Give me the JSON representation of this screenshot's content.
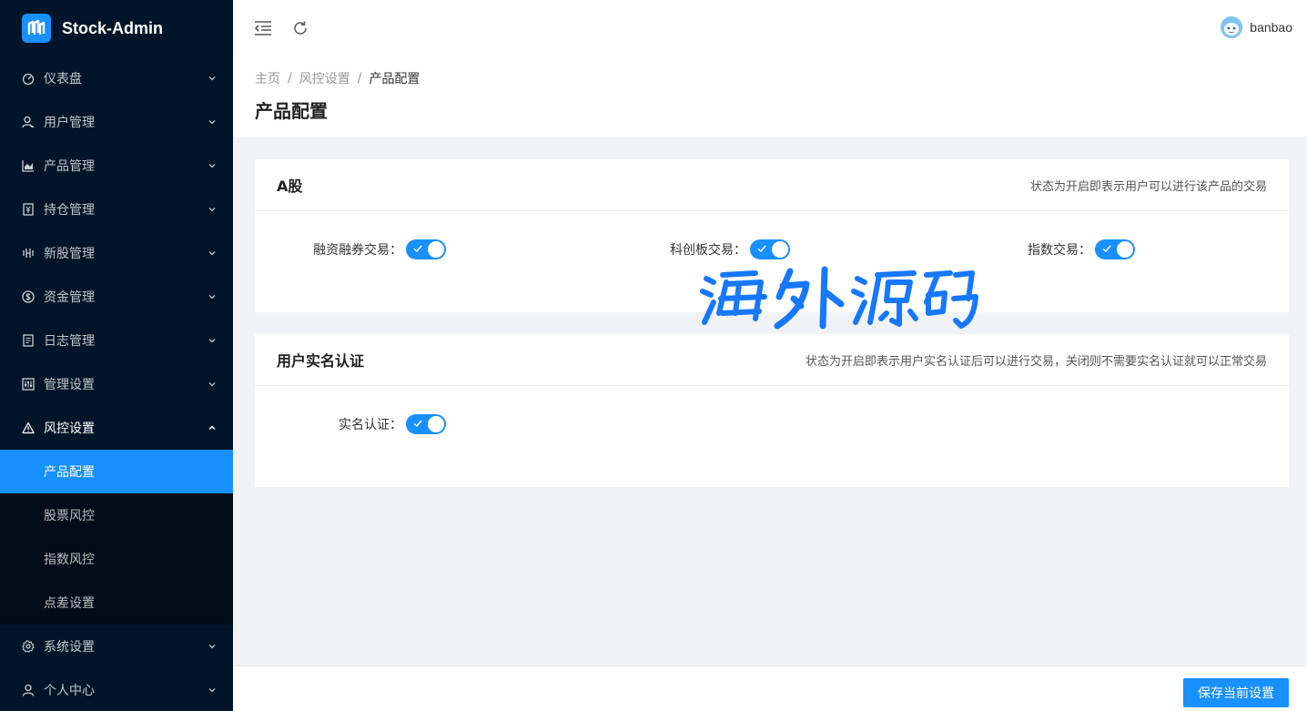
{
  "app": {
    "title": "Stock-Admin"
  },
  "sidebar": {
    "items": [
      {
        "label": "仪表盘",
        "icon": "dashboard-icon"
      },
      {
        "label": "用户管理",
        "icon": "user-manage-icon"
      },
      {
        "label": "产品管理",
        "icon": "area-chart-icon"
      },
      {
        "label": "持仓管理",
        "icon": "account-book-icon"
      },
      {
        "label": "新股管理",
        "icon": "bars-icon"
      },
      {
        "label": "资金管理",
        "icon": "dollar-icon"
      },
      {
        "label": "日志管理",
        "icon": "log-icon"
      },
      {
        "label": "管理设置",
        "icon": "setting-box-icon"
      },
      {
        "label": "风控设置",
        "icon": "warning-icon"
      }
    ],
    "submenu": [
      {
        "label": "产品配置"
      },
      {
        "label": "股票风控"
      },
      {
        "label": "指数风控"
      },
      {
        "label": "点差设置"
      }
    ],
    "bottom_items": [
      {
        "label": "系统设置",
        "icon": "gear-icon"
      },
      {
        "label": "个人中心",
        "icon": "person-icon"
      }
    ]
  },
  "header": {
    "user_name": "banbao"
  },
  "breadcrumb": [
    "主页",
    "风控设置",
    "产品配置"
  ],
  "page": {
    "title": "产品配置"
  },
  "cards": {
    "a_share": {
      "title": "A股",
      "note": "状态为开启即表示用户可以进行该产品的交易",
      "fields": [
        {
          "label": "融资融券交易：",
          "enabled": true
        },
        {
          "label": "科创板交易：",
          "enabled": true
        },
        {
          "label": "指数交易：",
          "enabled": true
        }
      ]
    },
    "realname": {
      "title": "用户实名认证",
      "note": "状态为开启即表示用户实名认证后可以进行交易，关闭则不需要实名认证就可以正常交易",
      "fields": [
        {
          "label": "实名认证：",
          "enabled": true
        }
      ]
    }
  },
  "watermark": {
    "text": "海外源码"
  },
  "footer": {
    "save_label": "保存当前设置"
  },
  "colors": {
    "primary": "#1890ff",
    "sidebar_bg": "#001529",
    "submenu_bg": "#000c17"
  }
}
